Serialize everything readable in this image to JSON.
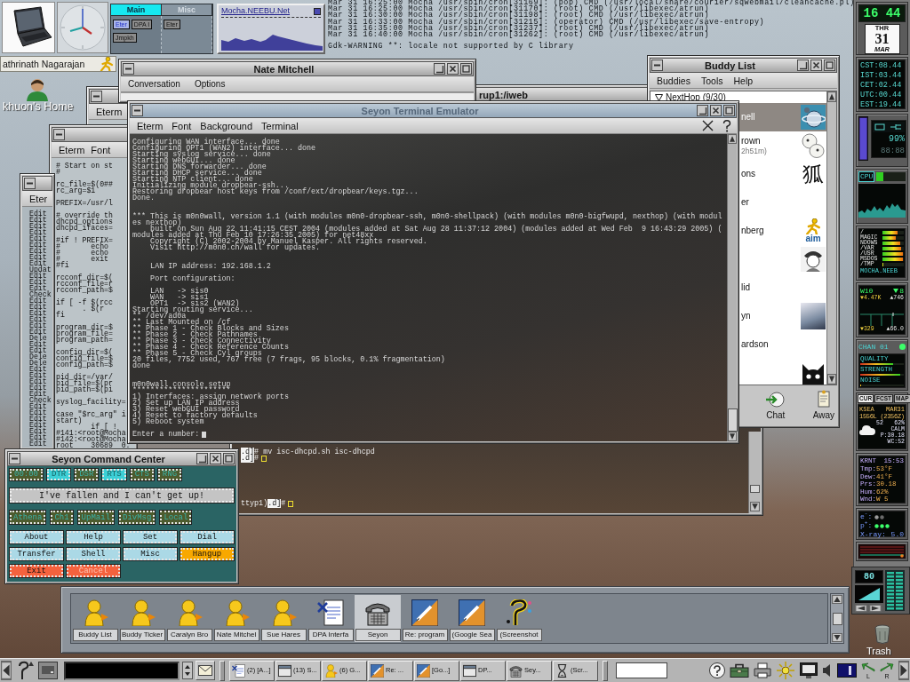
{
  "top_dock": {
    "pager": {
      "tabs": [
        {
          "label": "Main",
          "selected": true
        },
        {
          "label": "Misc",
          "selected": false
        }
      ],
      "desks": [
        {
          "windows": [
            {
              "label": "Eter",
              "selected": true
            },
            {
              "label": "DPA I",
              "selected": false
            },
            {
              "label": "Jmpkh",
              "selected": false
            }
          ]
        },
        {
          "windows": [
            {
              "label": "Eter",
              "selected": false
            }
          ]
        }
      ]
    },
    "net_monitor": {
      "host": "Mocha.NEEBU.Net"
    }
  },
  "log": {
    "lines": [
      "Mar 31 16:25:00 Mocha /usr/sbin/cron[31169]: (pop) CMD (/usr/local/share/courier/sqwebmail/cleancache.pl)",
      "Mar 31 16:25:00 Mocha /usr/sbin/cron[31170]: (root) CMD (/usr/libexec/atrun)",
      "Mar 31 16:30:00 Mocha /usr/sbin/cron[31198]: (root) CMD (/usr/libexec/atrun)",
      "Mar 31 16:33:00 Mocha /usr/sbin/cron[31215]: (operator) CMD (/usr/libexec/save-entropy)",
      "Mar 31 16:35:00 Mocha /usr/sbin/cron[31237]: (root) CMD (/usr/libexec/atrun)",
      "Mar 31 16:40:00 Mocha /usr/sbin/cron[31262]: (root) CMD (/usr/libexec/atrun)"
    ],
    "warning": "Gdk-WARNING **: locale not supported by C library"
  },
  "aim_bar": {
    "user": "athrinath Nagarajan"
  },
  "home_icon": {
    "label": "khuon's Home"
  },
  "shell_window": {
    "title": "rup1:/iweb",
    "lines": [
      {
        "prompt": ".d]",
        "text": "# mv isc-dhcpd.sh isc-dhcpd",
        "cursor": false
      },
      {
        "prompt": ".d]",
        "text": "#",
        "cursor": true
      }
    ],
    "status_line": {
      "tty": "ttyp1)",
      "prompt": ".d]",
      "text": "#",
      "cursor": true
    }
  },
  "eterm_windows": [
    {
      "menu": [
        "Eterm"
      ]
    },
    {
      "menu": [
        "Eter"
      ],
      "text": "Edit\nEdit\nEdit\nEdit\nEdit\nEdit\nEdit\nEdit\nEdit\nUpdat\nEdit\nEdit\nEdit\nCheck\nEdit\nEdit\nEdit\nEdit\nEdit\nEdit\nDele\nEdit\nEdit\nDele\nDele\nEdit\nEdit\nEdit\nEdit\nEdit\nCheck\nEdit\nEdit\nEdit\nEdit\nEdit\nEdit\nEdit"
    },
    {
      "menu": [
        "Eterm",
        "Font"
      ],
      "text": "# Start on st\n#\n\nrc_file=$(0##\nrc_arg=$1\n\nPREFIX=/usr/l\n\n# override th\ndhcpd_options\ndhcpd_ifaces=\n\n#if ! PREFIX=\n#       echo\n#       echo\n#       exit\n#fi\n\nrcconf_dir=$(\nrcconf_file=r\nrcconf_path=$\n\nif [ -f $(rcc\n      . $(r\nfi\n\nprogram_dir=$\nprogram_file=\nprogram_path=\n\nconfig_dir=$(\nconfig_file=$\nconfig_path=$\n\npid_dir=/var/\npid_file=$(pr\npid_path=$(pi\n\nsyslog_facility=\n\ncase \"$rc_arg\" i\nstart)\n        if [ !\n#141:<root@Mocha\n#142:<root@Mocha\nroot    30689  0."
    }
  ],
  "nate_window": {
    "title": "Nate Mitchell",
    "menu": [
      "Conversation",
      "Options"
    ]
  },
  "buddy_list": {
    "title": "Buddy List",
    "menu": [
      "Buddies",
      "Tools",
      "Help"
    ],
    "group": {
      "name": "NextHop (9/30)",
      "expanded": true
    },
    "buddies": [
      {
        "name": "nell",
        "kind": "globe",
        "selected": true
      },
      {
        "name": "rown",
        "idle": "2h51m)",
        "kind": "eggs",
        "selected": false
      },
      {
        "name": "ons",
        "kind": "glyph",
        "glyph": "狐",
        "selected": false
      },
      {
        "name": "er",
        "kind": "plain",
        "selected": false
      },
      {
        "name": "nberg",
        "kind": "aim",
        "logo": "aim",
        "selected": false
      },
      {
        "kind": "cartoon",
        "selected": false
      },
      {
        "name": "lid",
        "kind": "plain",
        "selected": false
      },
      {
        "name": "yn",
        "kind": "photo",
        "selected": false
      },
      {
        "name": "ardson",
        "kind": "plain",
        "selected": false
      },
      {
        "kind": "cat",
        "selected": false
      }
    ],
    "actions": [
      {
        "kind": "chat",
        "label": "Chat"
      },
      {
        "kind": "away",
        "label": "Away"
      }
    ]
  },
  "terminal": {
    "title": "Seyon Terminal Emulator",
    "menu": [
      "Eterm",
      "Font",
      "Background",
      "Terminal"
    ],
    "output": "Configuring WAN interface... done\nConfiguring OPT1 (WAN2) interface... done\nStarting syslog service... done\nStarting webGUI... done\nStarting DNS forwarder... done\nStarting DHCP service... done\nStarting NTP client... done\nInitializing module dropbear-ssh...\nRestoring dropbear host keys from /conf/ext/dropbear/keys.tgz...\nDone.\n\n\n*** This is m0n0wall, version 1.1 (with modules m0n0-dropbear-ssh, m0n0-shellpack) (with modules m0n0-bigfwupd, nexthop) (with modul\nes nexthop)\n    built on Sun Aug 22 11:41:15 CEST 2004 (modules added at Sat Aug 28 11:37:12 2004) (modules added at Wed Feb  9 16:43:29 2005) (\nmodules added at Thu Feb 10 17:26:35 2005) for net48xx\n    Copyright (C) 2002-2004 by Manuel Kasper. All rights reserved.\n    Visit http://m0n0.ch/wall for updates.\n\n\n    LAN IP address: 192.168.1.2\n\n    Port configuration:\n\n    LAN   -> sis0\n    WAN   -> sis1\n    OPT1  -> sis2 (WAN2)\nStarting routing service...\n** /dev/ad0a\n** Last Mounted on /cf\n** Phase 1 - Check Blocks and Sizes\n** Phase 2 - Check Pathnames\n** Phase 3 - Check Connectivity\n** Phase 4 - Check Reference Counts\n** Phase 5 - Check Cyl groups\n20 files, 7752 used, 767 free (7 frags, 95 blocks, 0.1% fragmentation)\ndone\n\n\nm0n0wall console setup\n**********************\n1) Interfaces: assign network ports\n2) Set up LAN IP address\n3) Reset webGUI password\n4) Reset to factory defaults\n5) Reboot system",
    "prompt": "Enter a number:"
  },
  "command_center": {
    "title": "Seyon Command Center",
    "timer": "00:00",
    "lights": [
      {
        "label": "DTR",
        "on": true
      },
      {
        "label": "DSR",
        "on": false
      },
      {
        "label": "RTS",
        "on": true
      },
      {
        "label": "CTS",
        "on": false
      },
      {
        "label": "RNG",
        "on": false
      }
    ],
    "banner": "I've fallen and I can't get up!",
    "scripts": [
      "Athena",
      "Ch1",
      "UpMail",
      "DivMsg",
      "Local"
    ],
    "buttons": [
      {
        "label": "About",
        "kind": "normal",
        "disabled": false
      },
      {
        "label": "Help",
        "kind": "normal",
        "disabled": false
      },
      {
        "label": "Set",
        "kind": "normal",
        "disabled": false
      },
      {
        "label": "Dial",
        "kind": "normal",
        "disabled": false
      },
      {
        "label": "Transfer",
        "kind": "normal",
        "disabled": false
      },
      {
        "label": "Shell",
        "kind": "normal",
        "disabled": false
      },
      {
        "label": "Misc",
        "kind": "normal",
        "disabled": false
      },
      {
        "label": "Hangup",
        "kind": "warn",
        "disabled": false
      },
      {
        "label": "Exit",
        "kind": "danger",
        "disabled": false
      },
      {
        "label": "Cancel",
        "kind": "danger",
        "disabled": true
      }
    ]
  },
  "dock": {
    "items": [
      {
        "kind": "person",
        "label": "Buddy List",
        "selected": false
      },
      {
        "kind": "person",
        "label": "Buddy Ticker",
        "selected": false
      },
      {
        "kind": "person",
        "label": "Caralyn Bro",
        "selected": false
      },
      {
        "kind": "person",
        "label": "Nate Mitchel",
        "selected": false
      },
      {
        "kind": "person",
        "label": "Sue Hares",
        "selected": false
      },
      {
        "kind": "document",
        "label": "DPA Interfa",
        "selected": false
      },
      {
        "kind": "phone",
        "label": "Seyon",
        "selected": true
      },
      {
        "kind": "browser",
        "label": "Re: program",
        "selected": false
      },
      {
        "kind": "browser",
        "label": "(Google Sea",
        "selected": false
      },
      {
        "kind": "hook",
        "label": "(Screenshot",
        "selected": false
      }
    ]
  },
  "mixer": {
    "value": "80"
  },
  "trash": {
    "label": "Trash"
  },
  "side_dock": {
    "clock": {
      "time": "16 44",
      "weekday": "THR",
      "day": "31",
      "month": "MAR"
    },
    "zones": [
      "CST:08.44",
      "IST:03.44",
      "CET:02.44",
      "UTC:00.44",
      "EST:19.44"
    ],
    "battery": {
      "level": 0.99,
      "percent": "99%",
      "timer": "88:88"
    },
    "cpu": {
      "label": "CPU",
      "level": 0.22
    },
    "disks": {
      "mounts": [
        {
          "name": "/",
          "level": 0.7
        },
        {
          "name": "MAGIC",
          "level": 0.62
        },
        {
          "name": "NDOWS",
          "level": 0.85
        },
        {
          "name": "/VAR",
          "level": 0.88
        },
        {
          "name": "/USR",
          "level": 0.95
        },
        {
          "name": "MSDOS",
          "level": 0.95
        },
        {
          "name": "/TMP",
          "level": 0.05
        }
      ],
      "host": "MOCHA.NEEB"
    },
    "net": {
      "iface": "W10",
      "count": "8",
      "down": "▼4.47K",
      "up": "▲746",
      "down_total": "▼329",
      "up_total": "▲66.0"
    },
    "wireless": {
      "channel": "CHAN 01",
      "meters": [
        {
          "label": "QUALITY",
          "level": 0.75
        },
        {
          "label": "STRENGTH",
          "level": 0.92
        },
        {
          "label": "NOISE",
          "level": 0.03
        }
      ]
    },
    "weather": {
      "tabs": [
        {
          "label": "CUR",
          "selected": true
        },
        {
          "label": "FCST",
          "selected": false
        },
        {
          "label": "MAP",
          "selected": false
        }
      ],
      "station": "KSEA",
      "date": "MAR31",
      "time": "1556L (2356Z)",
      "temp": "52",
      "humidity": "62%",
      "wind": "CALM",
      "pressure": "P:30.18",
      "chill": "WC:52"
    },
    "conditions": {
      "station": "KRNT",
      "time": "15:53",
      "rows": [
        {
          "label": "Tmp:",
          "value": "53°F"
        },
        {
          "label": "Dew:",
          "value": "41°F"
        },
        {
          "label": "Prs:",
          "value": "30.18"
        },
        {
          "label": "Hum:",
          "value": "62%"
        },
        {
          "label": "Wnd:",
          "value": "W 5"
        }
      ]
    },
    "radiation": {
      "electron": "e$^{-}$:",
      "proton": "p$^{+}$:",
      "xray_label": "X-ray:",
      "xray": "5.0"
    }
  },
  "taskbar": {
    "tasks": [
      {
        "kind": "document",
        "label": "(2) [A...]"
      },
      {
        "kind": "window",
        "label": "(13) S..."
      },
      {
        "kind": "person",
        "label": "(6) G..."
      },
      {
        "kind": "browser",
        "label": "Re: ..."
      },
      {
        "kind": "browser",
        "label": "[Go...]"
      },
      {
        "kind": "window",
        "label": "DP..."
      },
      {
        "kind": "phone",
        "label": "Sey..."
      },
      {
        "kind": "hourglass",
        "label": "(Scr..."
      }
    ],
    "channels": [
      "L",
      "R"
    ]
  }
}
